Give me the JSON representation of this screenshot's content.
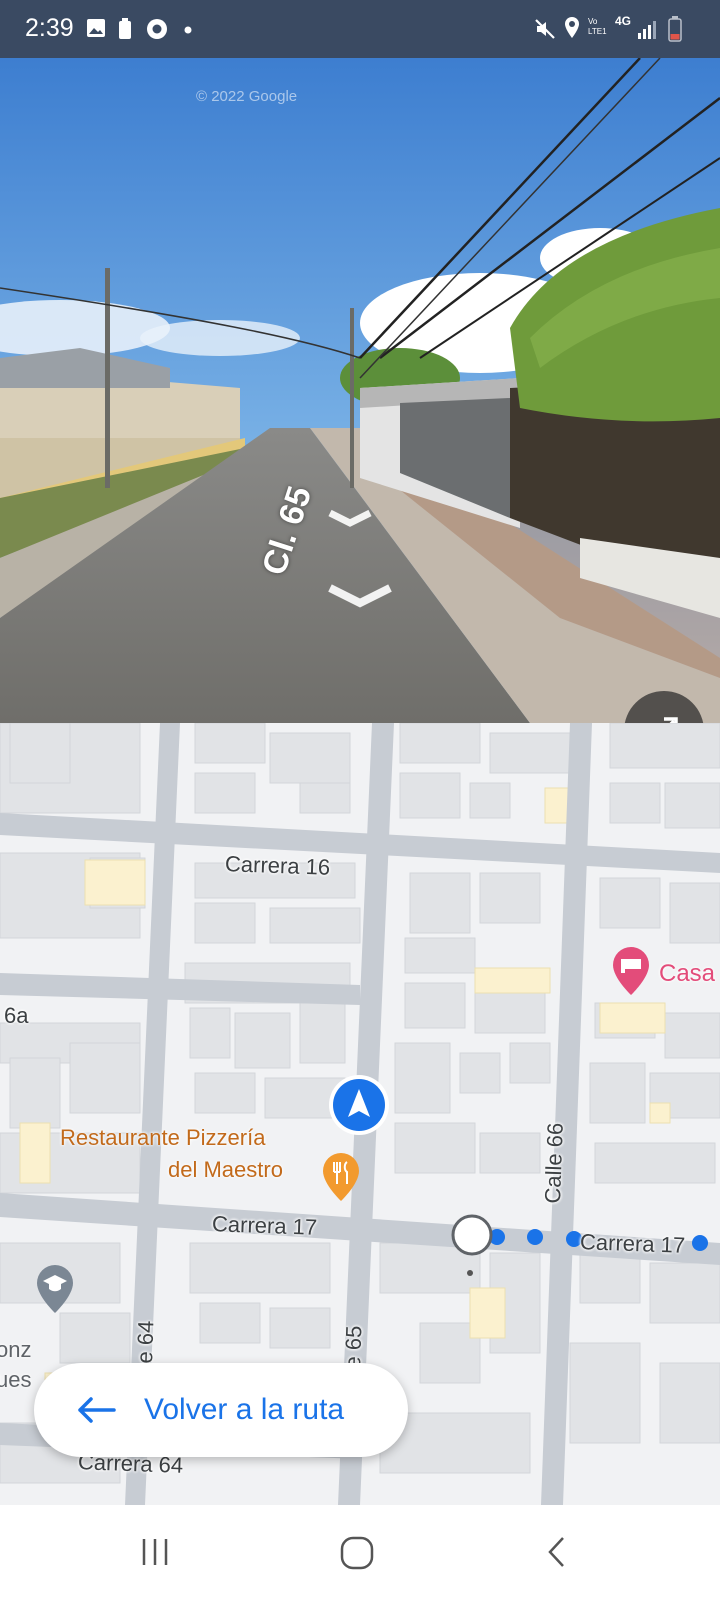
{
  "status_bar": {
    "time": "2:39",
    "left_icons": [
      "image-icon",
      "battery-saver-icon",
      "chrome-icon",
      "dot-icon"
    ],
    "right_icons": [
      "mute-icon",
      "location-icon",
      "volte-icon",
      "4g-icon",
      "signal-icon",
      "battery-icon"
    ],
    "volte_text": "Vo LTE1",
    "network_text": "4G"
  },
  "street_view": {
    "watermark": "© 2022 Google",
    "street_label": "Cl. 65",
    "expand_icon": "expand-icon"
  },
  "map": {
    "street_labels": {
      "carrera16": "Carrera 16",
      "carrera17_left": "Carrera 17",
      "carrera17_right": "Carrera 17",
      "calle66": "Calle 66",
      "calle64_partial": "e 64",
      "calle65_partial": "e 65",
      "carrera64_partial": "Carrera 64",
      "calle66a_partial": "6a"
    },
    "poi": {
      "restaurant_line1": "Restaurante Pizzería",
      "restaurant_line2": "del Maestro",
      "hotel": "Casa",
      "school_partial_1": "onz",
      "school_partial_2": "ues"
    },
    "colors": {
      "road": "#c7ccd3",
      "block": "#f1f2f4",
      "building": "#e1e3e6",
      "poi_orange": "#c26a1b",
      "hotel_pink": "#e34c7a",
      "route_blue": "#1a73e8"
    }
  },
  "back_to_route": {
    "label": "Volver a la ruta",
    "icon": "arrow-left-icon"
  },
  "nav_bar": {
    "buttons": [
      "recents-icon",
      "home-icon",
      "back-icon"
    ]
  }
}
